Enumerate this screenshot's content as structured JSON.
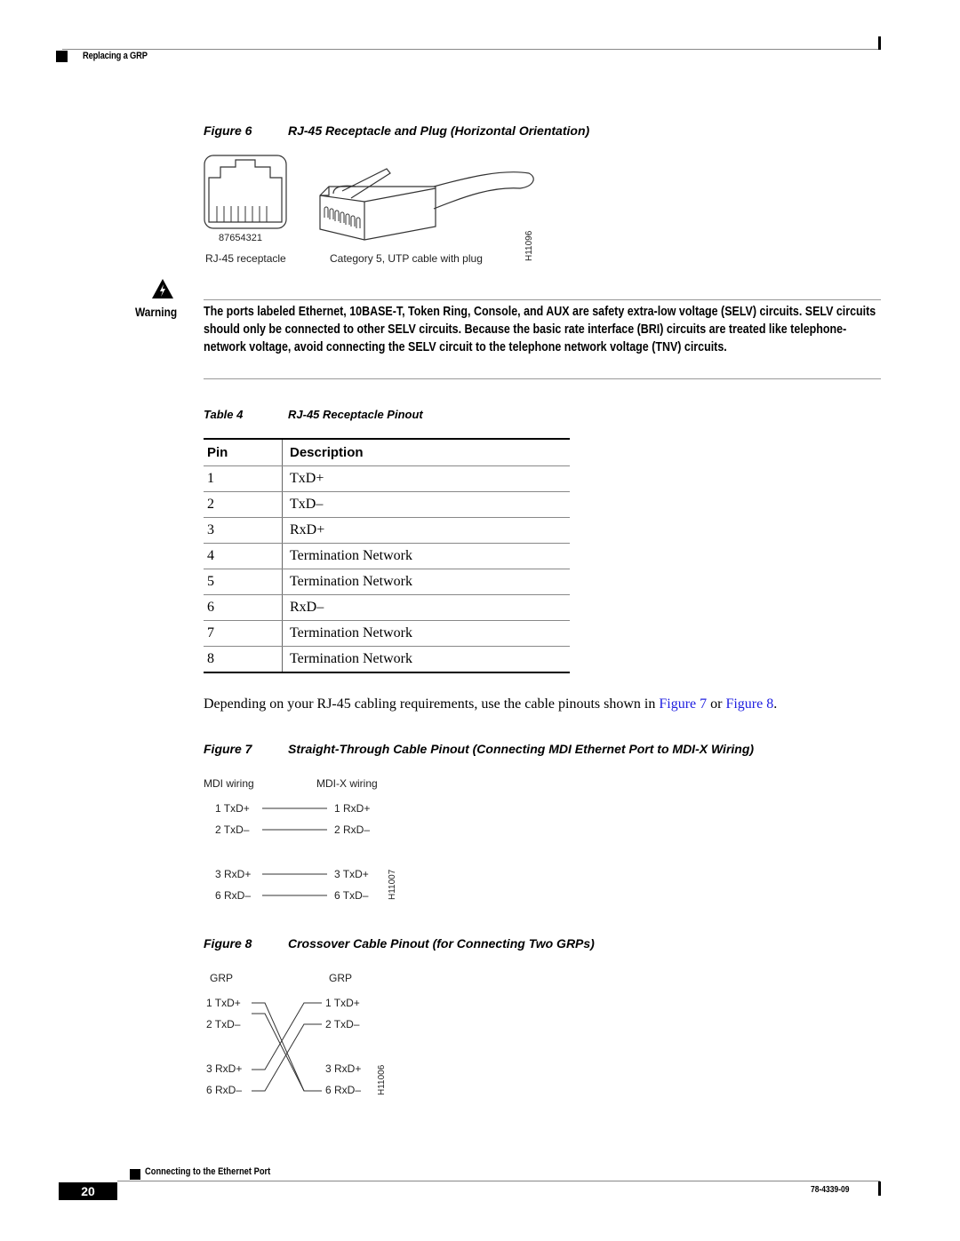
{
  "header": {
    "section_title": "Replacing a GRP"
  },
  "figure6": {
    "number": "Figure 6",
    "title": "RJ-45 Receptacle and Plug (Horizontal Orientation)",
    "pin_numbers": "87654321",
    "receptacle_label": "RJ-45 receptacle",
    "plug_label": "Category 5, UTP cable with plug",
    "art_id": "H11096"
  },
  "warning": {
    "label": "Warning",
    "text": "The ports labeled Ethernet, 10BASE-T, Token Ring, Console, and AUX are safety extra-low voltage (SELV) circuits. SELV circuits should only be connected to other SELV circuits. Because the basic rate interface (BRI) circuits are treated like telephone-network voltage, avoid connecting the SELV circuit to the telephone network voltage (TNV) circuits."
  },
  "table4": {
    "number": "Table 4",
    "title": "RJ-45 Receptacle Pinout",
    "headers": [
      "Pin",
      "Description"
    ],
    "rows": [
      [
        "1",
        "TxD+"
      ],
      [
        "2",
        "TxD–"
      ],
      [
        "3",
        "RxD+"
      ],
      [
        "4",
        "Termination Network"
      ],
      [
        "5",
        "Termination Network"
      ],
      [
        "6",
        "RxD–"
      ],
      [
        "7",
        "Termination Network"
      ],
      [
        "8",
        "Termination Network"
      ]
    ]
  },
  "paragraph": {
    "before": "Depending on your RJ-45 cabling requirements, use the cable pinouts shown in ",
    "link1": "Figure 7",
    "middle": " or ",
    "link2": "Figure 8",
    "after": "."
  },
  "figure7": {
    "number": "Figure 7",
    "title": "Straight-Through Cable Pinout (Connecting MDI Ethernet Port to MDI-X Wiring)",
    "left_header": "MDI wiring",
    "right_header": "MDI-X wiring",
    "left": [
      "1 TxD+",
      "2 TxD–",
      "3 RxD+",
      "6 RxD–"
    ],
    "right": [
      "1 RxD+",
      "2 RxD–",
      "3 TxD+",
      "6 TxD–"
    ],
    "art_id": "H11007"
  },
  "figure8": {
    "number": "Figure 8",
    "title": "Crossover Cable Pinout (for Connecting Two GRPs)",
    "left_header": "GRP",
    "right_header": "GRP",
    "left": [
      "1 TxD+",
      "2 TxD–",
      "3 RxD+",
      "6 RxD–"
    ],
    "right": [
      "1 TxD+",
      "2 TxD–",
      "3 RxD+",
      "6 RxD–"
    ],
    "art_id": "H11006"
  },
  "footer": {
    "section_title": "Connecting to the Ethernet Port",
    "page_number": "20",
    "doc_number": "78-4339-09"
  }
}
